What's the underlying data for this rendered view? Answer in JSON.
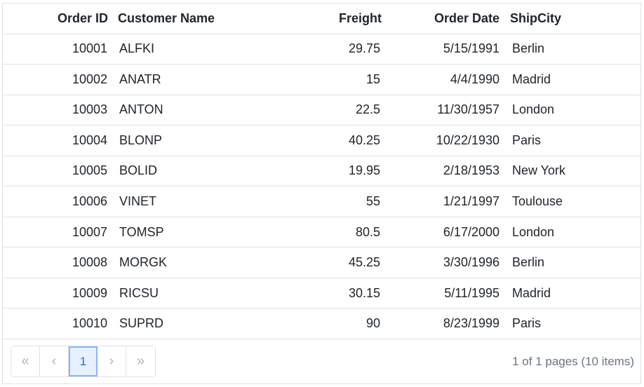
{
  "columns": {
    "order_id": "Order ID",
    "customer_name": "Customer Name",
    "freight": "Freight",
    "order_date": "Order Date",
    "ship_city": "ShipCity"
  },
  "rows": [
    {
      "order_id": "10001",
      "customer_name": "ALFKI",
      "freight": "29.75",
      "order_date": "5/15/1991",
      "ship_city": "Berlin"
    },
    {
      "order_id": "10002",
      "customer_name": "ANATR",
      "freight": "15",
      "order_date": "4/4/1990",
      "ship_city": "Madrid"
    },
    {
      "order_id": "10003",
      "customer_name": "ANTON",
      "freight": "22.5",
      "order_date": "11/30/1957",
      "ship_city": "London"
    },
    {
      "order_id": "10004",
      "customer_name": "BLONP",
      "freight": "40.25",
      "order_date": "10/22/1930",
      "ship_city": "Paris"
    },
    {
      "order_id": "10005",
      "customer_name": "BOLID",
      "freight": "19.95",
      "order_date": "2/18/1953",
      "ship_city": "New York"
    },
    {
      "order_id": "10006",
      "customer_name": "VINET",
      "freight": "55",
      "order_date": "1/21/1997",
      "ship_city": "Toulouse"
    },
    {
      "order_id": "10007",
      "customer_name": "TOMSP",
      "freight": "80.5",
      "order_date": "6/17/2000",
      "ship_city": "London"
    },
    {
      "order_id": "10008",
      "customer_name": "MORGK",
      "freight": "45.25",
      "order_date": "3/30/1996",
      "ship_city": "Berlin"
    },
    {
      "order_id": "10009",
      "customer_name": "RICSU",
      "freight": "30.15",
      "order_date": "5/11/1995",
      "ship_city": "Madrid"
    },
    {
      "order_id": "10010",
      "customer_name": "SUPRD",
      "freight": "90",
      "order_date": "8/23/1999",
      "ship_city": "Paris"
    }
  ],
  "pager": {
    "first": "«",
    "prev": "‹",
    "current_page": "1",
    "next": "›",
    "last": "»",
    "info": "1 of 1 pages (10 items)"
  },
  "colors": {
    "border": "#dee2e6",
    "active_page_bg": "#e7f1ff",
    "active_page_border": "#86b7fe",
    "active_page_text": "#0d6efd",
    "muted_text": "#6c757d"
  }
}
